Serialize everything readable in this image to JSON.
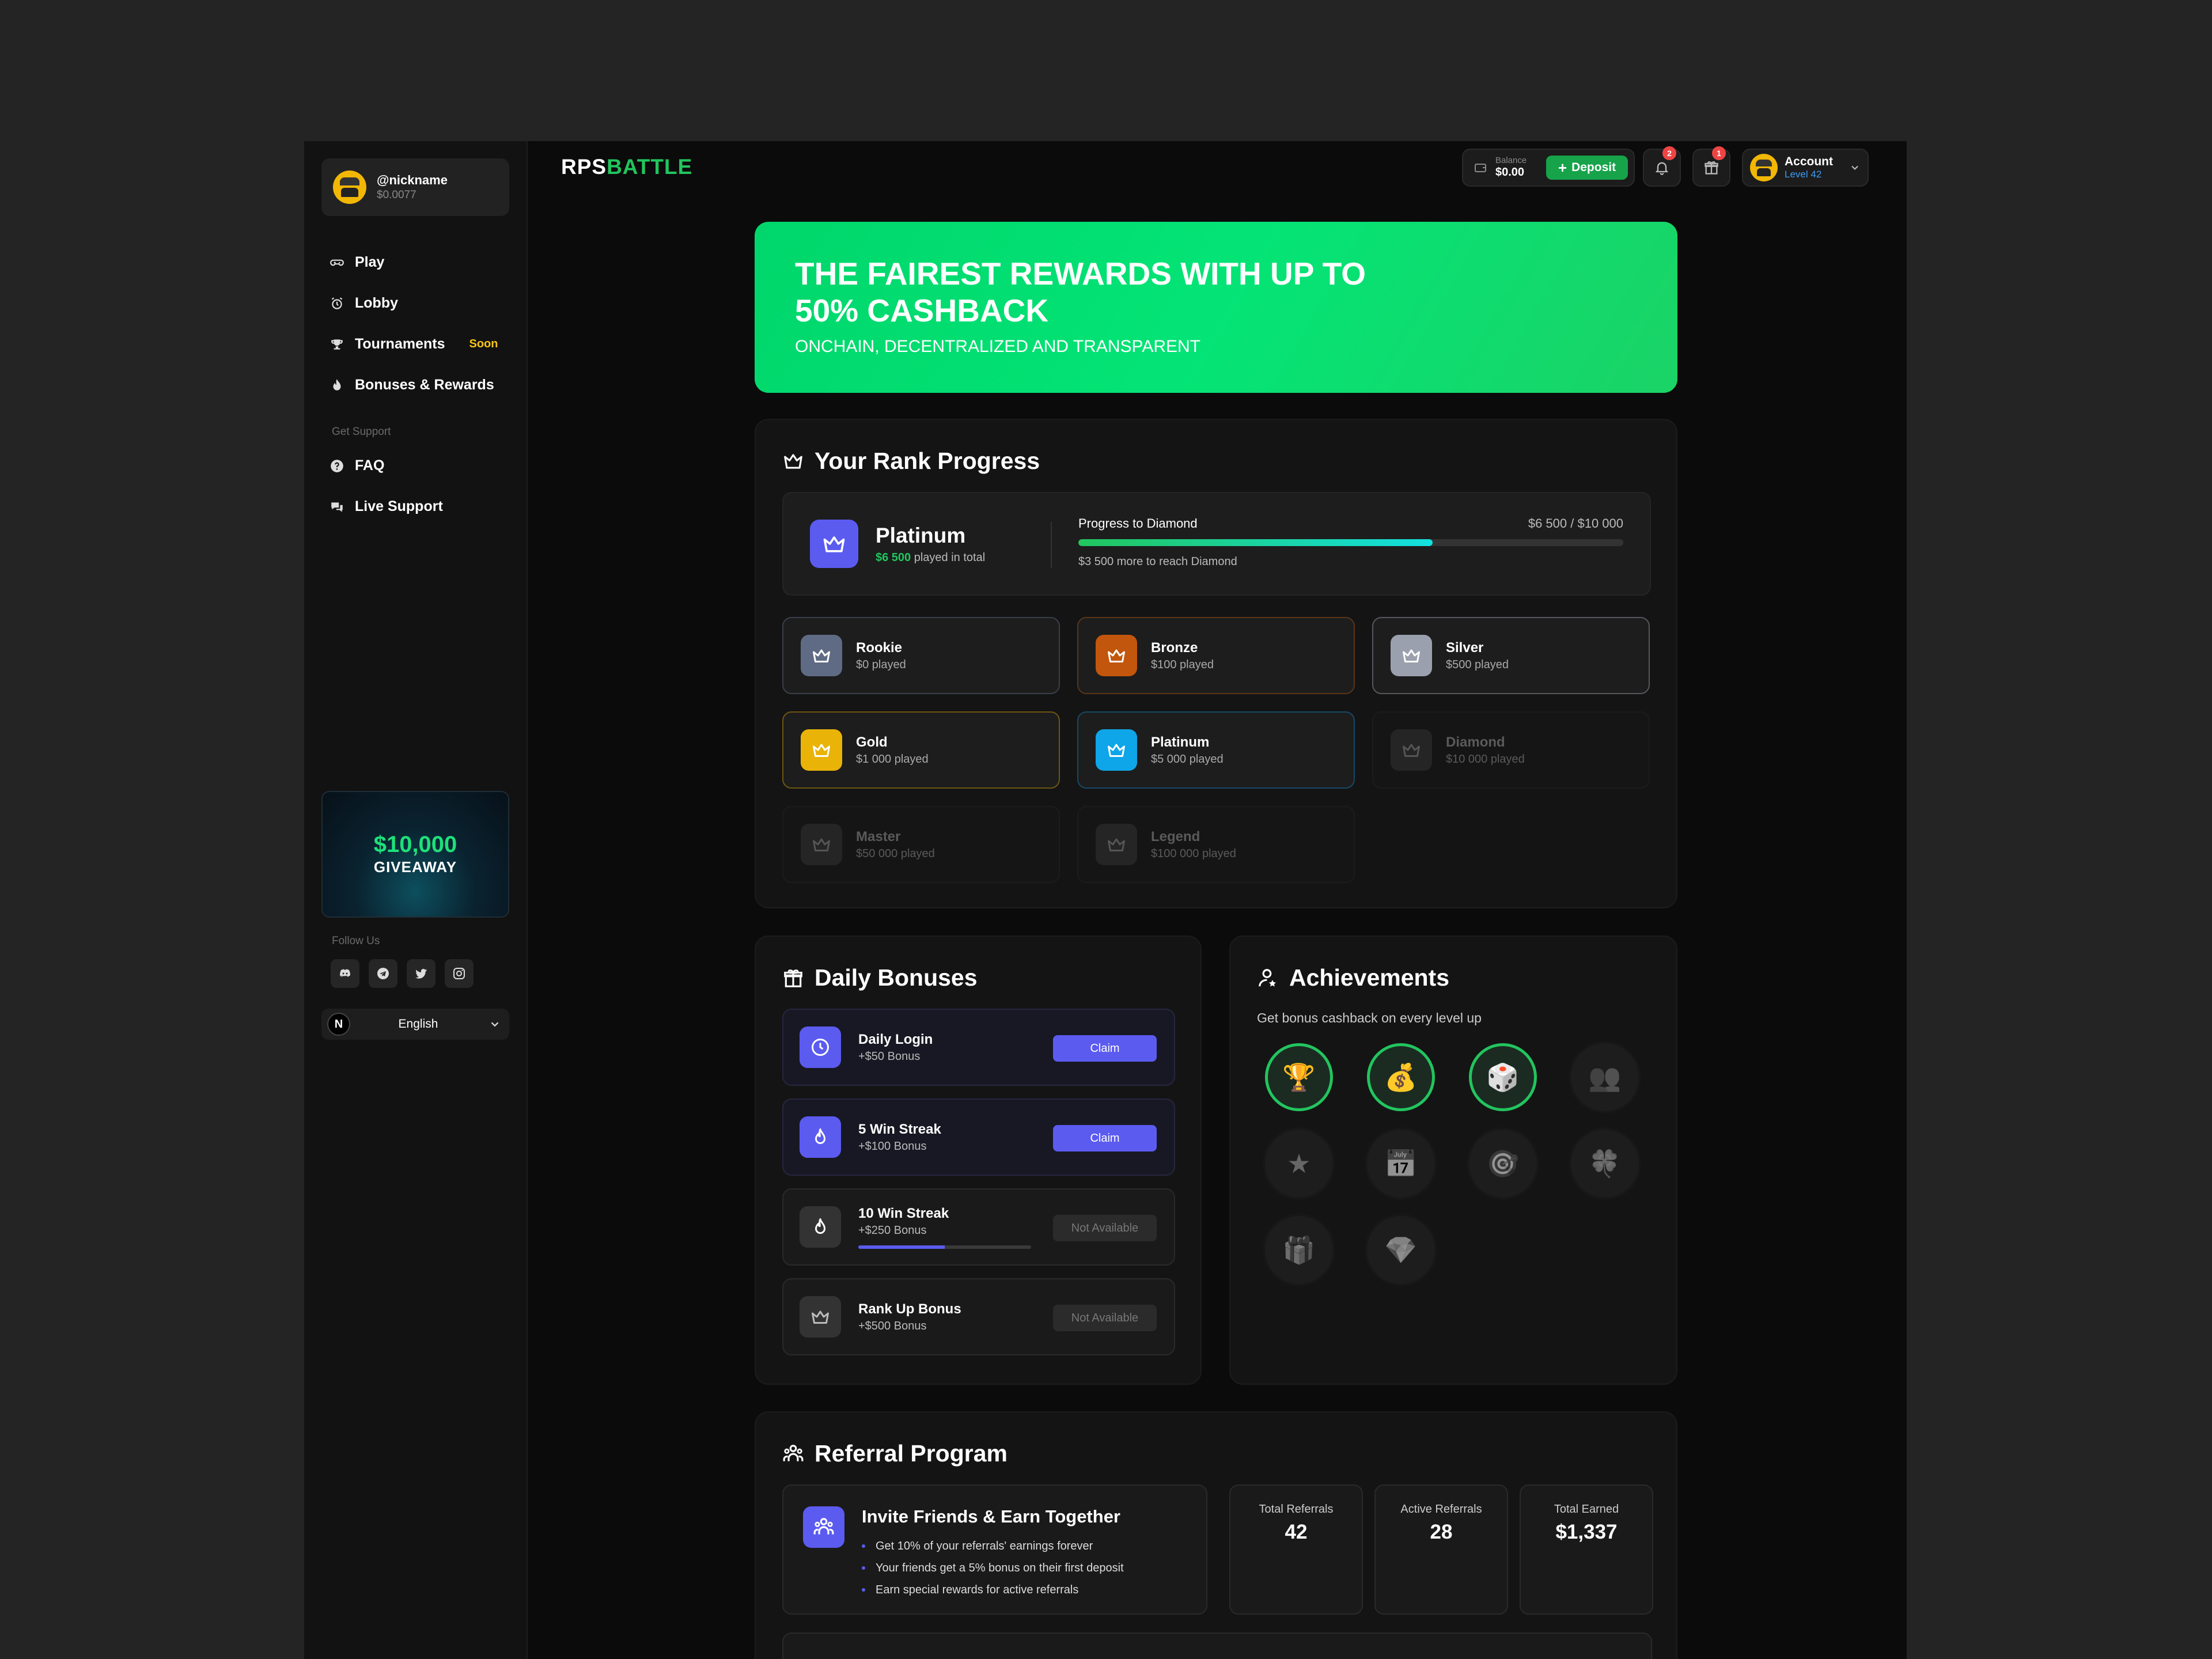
{
  "sidebar": {
    "profile": {
      "name": "@nickname",
      "balance": "$0.0077"
    },
    "nav": [
      {
        "label": "Play",
        "icon": "gamepad-icon"
      },
      {
        "label": "Lobby",
        "icon": "alarm-icon"
      },
      {
        "label": "Tournaments",
        "icon": "trophy-icon",
        "badge": "Soon"
      },
      {
        "label": "Bonuses & Rewards",
        "icon": "flame-icon"
      }
    ],
    "support_label": "Get Support",
    "support": [
      {
        "label": "FAQ",
        "icon": "question-icon"
      },
      {
        "label": "Live Support",
        "icon": "chat-icon"
      }
    ],
    "giveaway": {
      "amount": "$10,000",
      "label": "GIVEAWAY"
    },
    "follow_label": "Follow Us",
    "socials": [
      "discord-icon",
      "telegram-icon",
      "twitter-icon",
      "instagram-icon"
    ],
    "language": {
      "logo": "N",
      "value": "English"
    }
  },
  "header": {
    "logo_a": "RPS",
    "logo_b": "BATTLE",
    "balance_label": "Balance",
    "balance_value": "$0.00",
    "deposit_label": "Deposit",
    "notifications_count": "2",
    "gifts_count": "1",
    "account_label": "Account",
    "account_level": "Level 42"
  },
  "hero": {
    "title": "THE FAIREST REWARDS WITH UP TO 50% CASHBACK",
    "subtitle": "ONCHAIN, DECENTRALIZED AND TRANSPARENT"
  },
  "rank": {
    "title": "Your Rank Progress",
    "current": {
      "name": "Platinum",
      "played_value": "$6 500",
      "played_suffix": "played in total"
    },
    "progress_label": "Progress to Diamond",
    "progress_amount": "$6 500 / $10 000",
    "progress_fraction": 0.65,
    "progress_note": "$3 500 more to reach Diamond",
    "tiers": [
      {
        "name": "Rookie",
        "played": "$0 played",
        "color": "#5f6b84",
        "border": "#3a3f4a",
        "locked": false
      },
      {
        "name": "Bronze",
        "played": "$100 played",
        "color": "#c2560c",
        "border": "#5a3418",
        "locked": false
      },
      {
        "name": "Silver",
        "played": "$500 played",
        "color": "#9aa0ad",
        "border": "#55575d",
        "locked": false
      },
      {
        "name": "Gold",
        "played": "$1 000 played",
        "color": "#eab308",
        "border": "#6d5612",
        "locked": false
      },
      {
        "name": "Platinum",
        "played": "$5 000 played",
        "color": "#0ea5e9",
        "border": "#174a66",
        "locked": false
      },
      {
        "name": "Diamond",
        "played": "$10 000 played",
        "color": "#252525",
        "border": "#1c1c1c",
        "locked": true
      },
      {
        "name": "Master",
        "played": "$50 000 played",
        "color": "#252525",
        "border": "#1c1c1c",
        "locked": true
      },
      {
        "name": "Legend",
        "played": "$100 000 played",
        "color": "#252525",
        "border": "#1c1c1c",
        "locked": true
      }
    ]
  },
  "daily": {
    "title": "Daily Bonuses",
    "items": [
      {
        "name": "Daily Login",
        "sub": "+$50 Bonus",
        "action": "Claim",
        "icon": "clock-icon",
        "available": true
      },
      {
        "name": "5 Win Streak",
        "sub": "+$100 Bonus",
        "action": "Claim",
        "icon": "flame-icon",
        "available": true
      },
      {
        "name": "10 Win Streak",
        "sub": "+$250 Bonus",
        "action": "Not Available",
        "icon": "flame-icon",
        "available": false,
        "progress": 0.5
      },
      {
        "name": "Rank Up Bonus",
        "sub": "+$500 Bonus",
        "action": "Not Available",
        "icon": "crown-icon",
        "available": false
      }
    ]
  },
  "achievements": {
    "title": "Achievements",
    "subtitle": "Get bonus cashback on every level up",
    "medals": [
      {
        "icon": "trophy-icon",
        "glyph": "🏆",
        "unlocked": true
      },
      {
        "icon": "money-bag-icon",
        "glyph": "💰",
        "unlocked": true
      },
      {
        "icon": "dice-icon",
        "glyph": "🎲",
        "unlocked": true
      },
      {
        "icon": "users-icon",
        "glyph": "👥",
        "unlocked": false
      },
      {
        "icon": "star-icon",
        "glyph": "★",
        "unlocked": false
      },
      {
        "icon": "calendar-icon",
        "glyph": "📅",
        "unlocked": false
      },
      {
        "icon": "target-icon",
        "glyph": "🎯",
        "unlocked": false
      },
      {
        "icon": "clover-icon",
        "glyph": "🍀",
        "unlocked": false
      },
      {
        "icon": "gift-icon",
        "glyph": "🎁",
        "unlocked": false
      },
      {
        "icon": "diamond-icon",
        "glyph": "💎",
        "unlocked": false
      }
    ]
  },
  "referral": {
    "title": "Referral Program",
    "invite_title": "Invite Friends & Earn Together",
    "bullets": [
      "Get 10% of your referrals' earnings forever",
      "Your friends get a 5% bonus on their first deposit",
      "Earn special rewards for active referrals"
    ],
    "stats": [
      {
        "label": "Total Referrals",
        "value": "42"
      },
      {
        "label": "Active Referrals",
        "value": "28"
      },
      {
        "label": "Total Earned",
        "value": "$1,337"
      }
    ]
  },
  "colors": {
    "accent_green": "#22c55e",
    "accent_purple": "#5b5bf0",
    "badge_red": "#ef4444",
    "soon_yellow": "#f5c518"
  }
}
